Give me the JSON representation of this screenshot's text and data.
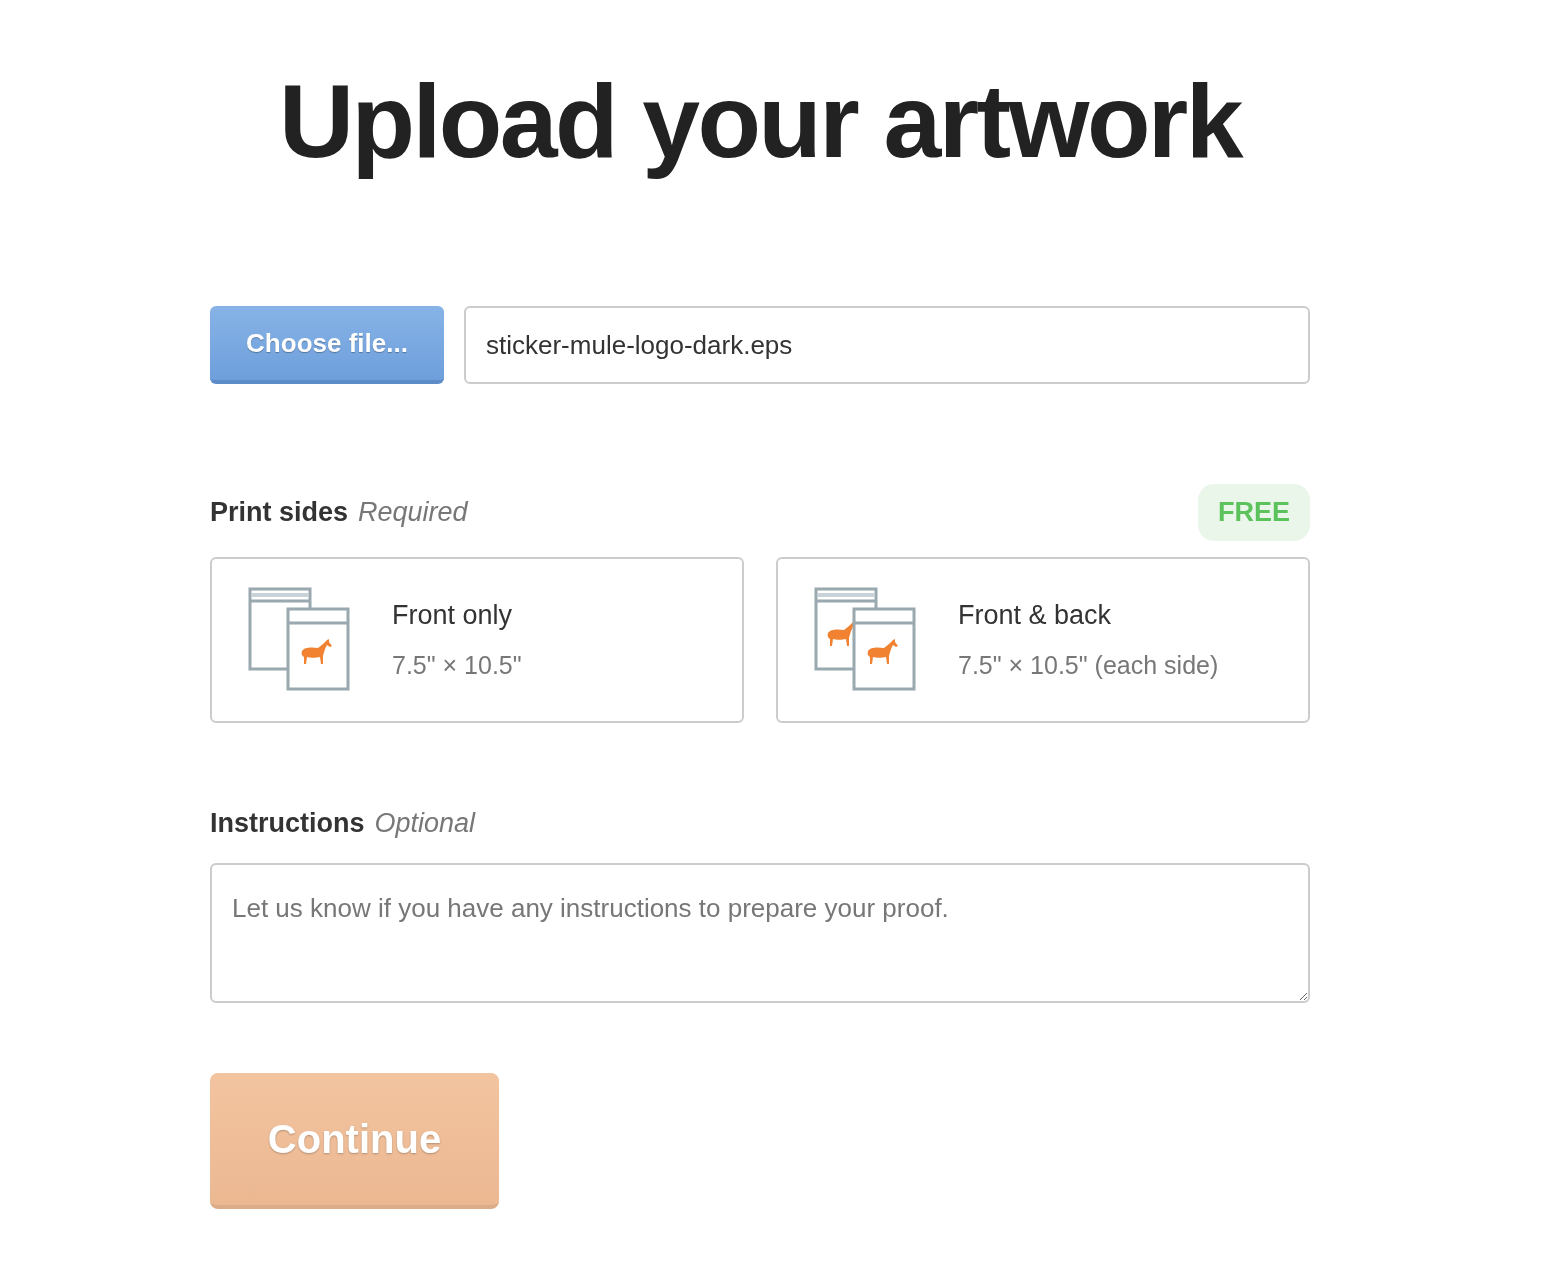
{
  "title": "Upload your artwork",
  "file": {
    "button": "Choose file...",
    "value": "sticker-mule-logo-dark.eps"
  },
  "print_sides": {
    "label": "Print sides",
    "note": "Required",
    "badge": "FREE",
    "options": [
      {
        "kind": "single",
        "title": "Front only",
        "size": "7.5\" × 10.5\"",
        "selected": false
      },
      {
        "kind": "double",
        "title": "Front & back",
        "size": "7.5\" × 10.5\" (each side)",
        "selected": false
      }
    ]
  },
  "instructions": {
    "label": "Instructions",
    "note": "Optional",
    "placeholder": "Let us know if you have any instructions to prepare your proof."
  },
  "continue": {
    "label": "Continue",
    "disabled": true
  }
}
